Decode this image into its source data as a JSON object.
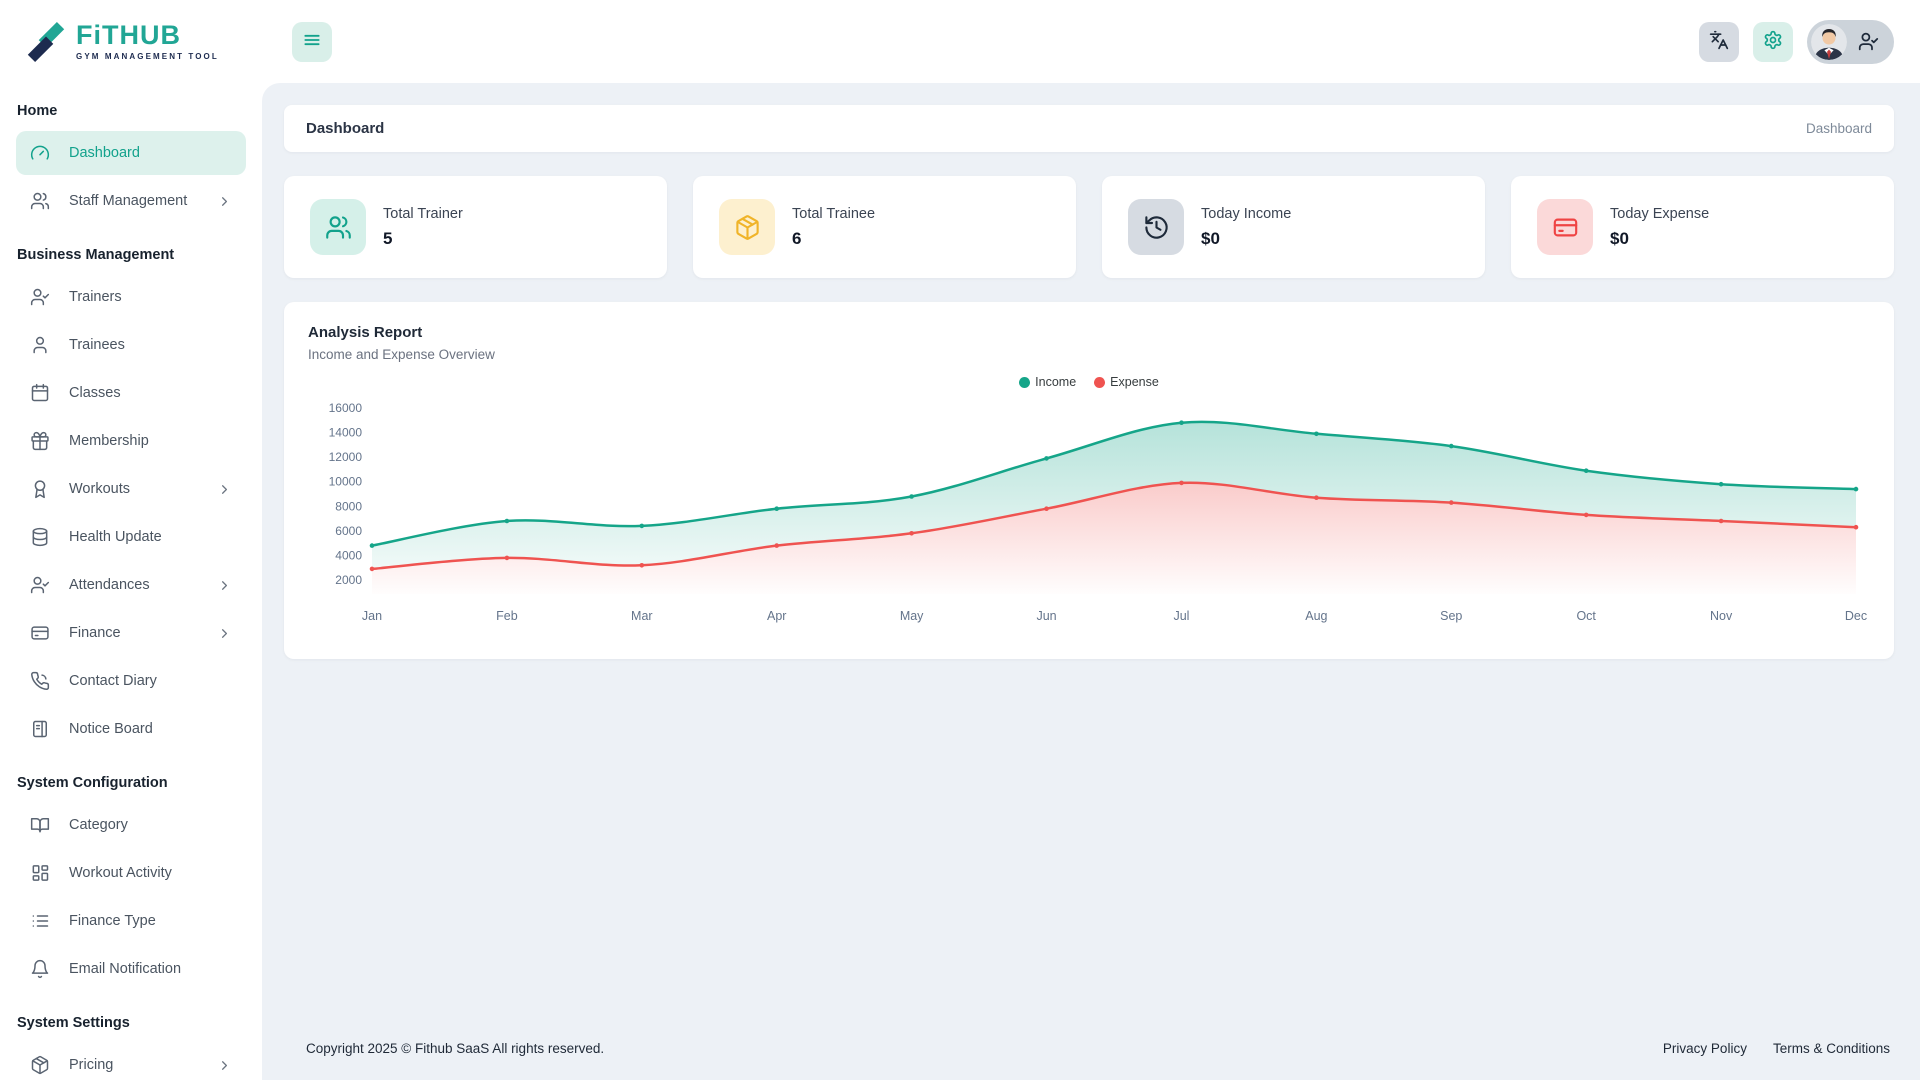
{
  "brand": {
    "title": "FiTHUB",
    "tagline": "GYM MANAGEMENT TOOL"
  },
  "topbar": {
    "icons": {
      "menu": "menu-icon",
      "translate": "languages-icon",
      "settings": "gear-icon",
      "profile": "user-check-icon"
    }
  },
  "page_header": {
    "title": "Dashboard",
    "breadcrumb": "Dashboard"
  },
  "sidebar": {
    "sections": [
      {
        "heading": "Home",
        "items": [
          {
            "label": "Dashboard",
            "icon": "gauge-icon",
            "active": true
          },
          {
            "label": "Staff Management",
            "icon": "users-icon",
            "chevron": true
          }
        ]
      },
      {
        "heading": "Business Management",
        "items": [
          {
            "label": "Trainers",
            "icon": "user-check-icon"
          },
          {
            "label": "Trainees",
            "icon": "user-icon"
          },
          {
            "label": "Classes",
            "icon": "calendar-icon"
          },
          {
            "label": "Membership",
            "icon": "gift-icon"
          },
          {
            "label": "Workouts",
            "icon": "award-icon",
            "chevron": true
          },
          {
            "label": "Health Update",
            "icon": "database-icon"
          },
          {
            "label": "Attendances",
            "icon": "user-check-icon",
            "chevron": true
          },
          {
            "label": "Finance",
            "icon": "credit-card-icon",
            "chevron": true
          },
          {
            "label": "Contact Diary",
            "icon": "phone-icon"
          },
          {
            "label": "Notice Board",
            "icon": "board-icon"
          }
        ]
      },
      {
        "heading": "System Configuration",
        "items": [
          {
            "label": "Category",
            "icon": "book-open-icon"
          },
          {
            "label": "Workout Activity",
            "icon": "layout-grid-icon"
          },
          {
            "label": "Finance Type",
            "icon": "list-icon"
          },
          {
            "label": "Email Notification",
            "icon": "bell-icon"
          }
        ]
      },
      {
        "heading": "System Settings",
        "items": [
          {
            "label": "Pricing",
            "icon": "package-icon",
            "chevron": true
          }
        ]
      }
    ]
  },
  "stats": [
    {
      "label": "Total Trainer",
      "value": "5",
      "icon": "users-icon",
      "icon_color": "#12a28c",
      "icon_bg": "#d5f0e9"
    },
    {
      "label": "Total Trainee",
      "value": "6",
      "icon": "package-icon",
      "icon_color": "#f0b429",
      "icon_bg": "#fdf0cf"
    },
    {
      "label": "Today Income",
      "value": "$0",
      "icon": "history-icon",
      "icon_color": "#1e2a3a",
      "icon_bg": "#d6dbe2"
    },
    {
      "label": "Today Expense",
      "value": "$0",
      "icon": "credit-card-icon",
      "icon_color": "#ef4444",
      "icon_bg": "#fbd9d9"
    }
  ],
  "analysis": {
    "title": "Analysis Report",
    "subtitle": "Income and Expense Overview"
  },
  "chart_data": {
    "type": "area",
    "title": "Analysis Report",
    "subtitle": "Income and Expense Overview",
    "categories": [
      "Jan",
      "Feb",
      "Mar",
      "Apr",
      "May",
      "Jun",
      "Jul",
      "Aug",
      "Sep",
      "Oct",
      "Nov",
      "Dec"
    ],
    "series": [
      {
        "name": "Income",
        "color": "#15a589",
        "values": [
          4800,
          6800,
          6400,
          7800,
          8800,
          11900,
          14800,
          13900,
          12900,
          10900,
          9800,
          9400
        ]
      },
      {
        "name": "Expense",
        "color": "#ef5350",
        "values": [
          2900,
          3800,
          3200,
          4800,
          5800,
          7800,
          9900,
          8700,
          8300,
          7300,
          6800,
          6300
        ]
      }
    ],
    "ylim": [
      2000,
      16000
    ],
    "ytick_step": 2000,
    "legend_position": "top",
    "grid": false
  },
  "footer": {
    "copyright": "Copyright 2025 © Fithub SaaS All rights reserved.",
    "links": [
      "Privacy Policy",
      "Terms & Conditions"
    ]
  },
  "colors": {
    "accent": "#15a589",
    "expense": "#ef5350",
    "content_bg": "#edf1f6",
    "navy": "#1d2b4f"
  }
}
